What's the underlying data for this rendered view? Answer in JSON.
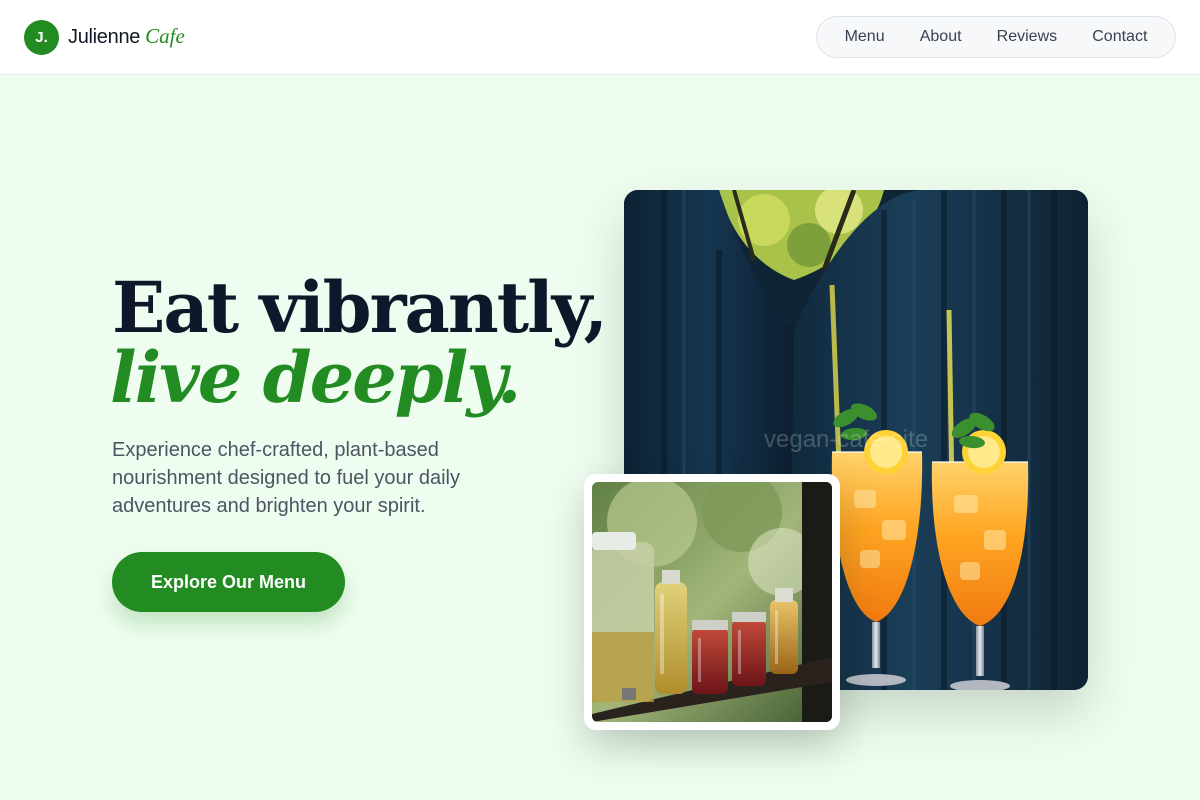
{
  "brand": {
    "badge": "J.",
    "name": "Julienne",
    "accent": "Cafe"
  },
  "nav": {
    "items": [
      "Menu",
      "About",
      "Reviews",
      "Contact"
    ]
  },
  "hero": {
    "headline_line1": "Eat vibrantly,",
    "headline_line2": "live deeply.",
    "subtext": "Experience chef-crafted, plant-based nourishment designed to fuel your daily adventures and brighten your spirit.",
    "cta_label": "Explore Our Menu"
  },
  "images": {
    "main": {
      "subject": "two orange iced drinks with straws, mint and lemon on a dark blue seat",
      "watermark": "vegan-cafe-site"
    },
    "secondary": {
      "subject": "glass jars of infused teas and syrups on a wooden shelf"
    }
  },
  "colors": {
    "accent": "#228b22",
    "page_background": "#effdf0",
    "heading": "#0f172a",
    "body_text": "#4b5563"
  }
}
